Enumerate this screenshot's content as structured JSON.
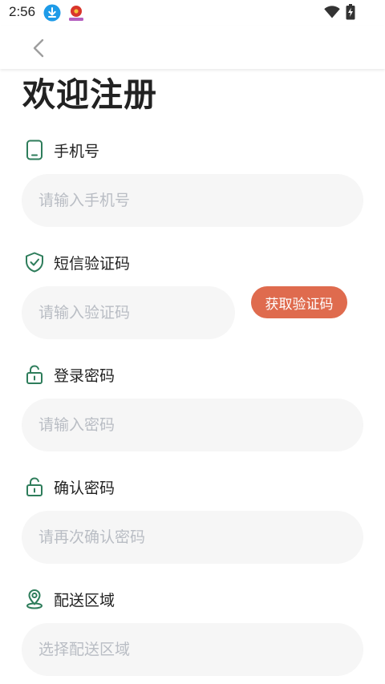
{
  "status_bar": {
    "time": "2:56"
  },
  "nav": {
    "back_icon": "chevron-left-icon"
  },
  "page": {
    "title": "欢迎注册"
  },
  "form": {
    "phone": {
      "label": "手机号",
      "placeholder": "请输入手机号",
      "value": "",
      "icon": "phone-icon"
    },
    "sms_code": {
      "label": "短信验证码",
      "placeholder": "请输入验证码",
      "value": "",
      "icon": "shield-check-icon",
      "button_label": "获取验证码"
    },
    "password": {
      "label": "登录密码",
      "placeholder": "请输入密码",
      "value": "",
      "icon": "lock-icon"
    },
    "confirm_password": {
      "label": "确认密码",
      "placeholder": "请再次确认密码",
      "value": "",
      "icon": "lock-icon"
    },
    "delivery_area": {
      "label": "配送区域",
      "placeholder": "选择配送区域",
      "value": "",
      "icon": "location-pin-icon"
    }
  },
  "colors": {
    "icon_green": "#2e7d5b",
    "button_orange": "#df6b4e",
    "input_bg": "#f6f6f6",
    "placeholder": "#b9bdc4",
    "download_blue": "#1e9be8"
  }
}
